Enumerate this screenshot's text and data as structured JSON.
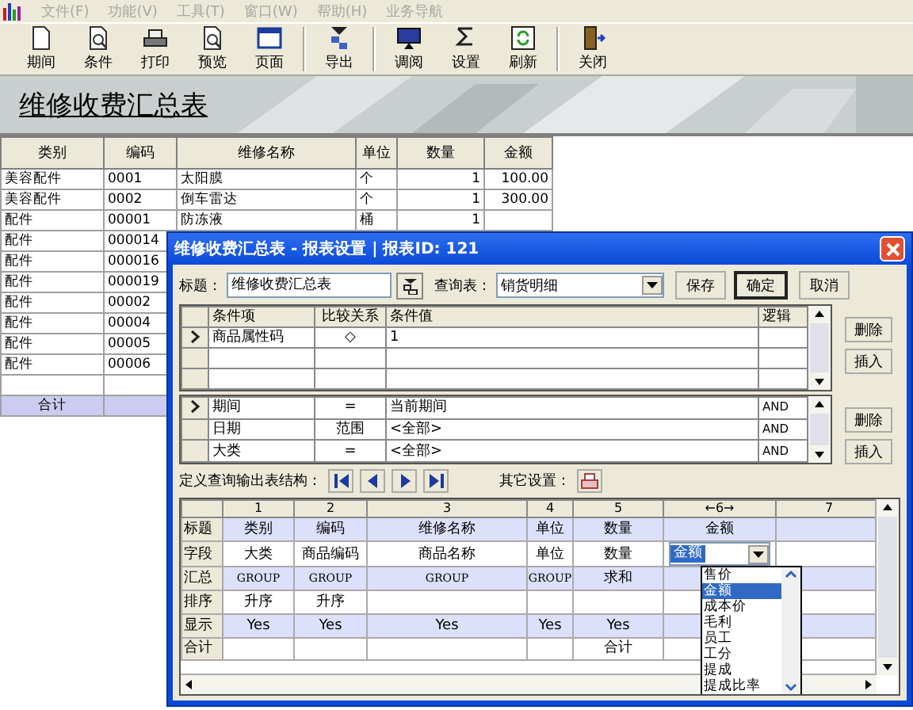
{
  "menu": [
    {
      "label": "文件(F)",
      "disabled": true
    },
    {
      "label": "功能(V)",
      "disabled": true
    },
    {
      "label": "工具(T)",
      "disabled": true
    },
    {
      "label": "窗口(W)",
      "disabled": true
    },
    {
      "label": "帮助(H)",
      "disabled": true
    },
    {
      "label": "业务导航",
      "disabled": true
    }
  ],
  "toolbar": [
    {
      "label": "期间"
    },
    {
      "label": "条件"
    },
    {
      "label": "打印"
    },
    {
      "label": "预览"
    },
    {
      "label": "页面"
    },
    {
      "label": "导出"
    },
    {
      "label": "调阅"
    },
    {
      "label": "设置"
    },
    {
      "label": "刷新"
    },
    {
      "label": "关闭"
    }
  ],
  "banner": {
    "title": "维修收费汇总表"
  },
  "report": {
    "columns": [
      "类别",
      "编码",
      "维修名称",
      "单位",
      "数量",
      "金额"
    ],
    "rows": [
      [
        "美容配件",
        "0001",
        "太阳膜",
        "个",
        "1",
        "100.00"
      ],
      [
        "美容配件",
        "0002",
        "倒车雷达",
        "个",
        "1",
        "300.00"
      ],
      [
        "配件",
        "00001",
        "防冻液",
        "桶",
        "1",
        ""
      ],
      [
        "配件",
        "000014",
        "",
        "",
        "",
        ""
      ],
      [
        "配件",
        "000016",
        "",
        "",
        "",
        ""
      ],
      [
        "配件",
        "000019",
        "",
        "",
        "",
        ""
      ],
      [
        "配件",
        "00002",
        "",
        "",
        "",
        ""
      ],
      [
        "配件",
        "00004",
        "",
        "",
        "",
        ""
      ],
      [
        "配件",
        "00005",
        "",
        "",
        "",
        ""
      ],
      [
        "配件",
        "00006",
        "",
        "",
        "",
        ""
      ],
      [
        "",
        "",
        "",
        "",
        "",
        ""
      ]
    ],
    "total_label": "合计"
  },
  "dialog": {
    "title": "维修收费汇总表 - 报表设置 | 报表ID: 121",
    "title_label": "标题：",
    "title_value": "维修收费汇总表",
    "query_label": "查询表：",
    "query_value": "销货明细",
    "buttons": [
      {
        "label": "保存",
        "default": false
      },
      {
        "label": "确定",
        "default": true
      },
      {
        "label": "取消",
        "default": false
      }
    ],
    "conditions": {
      "columns": [
        "条件项",
        "比较关系",
        "条件值",
        "逻辑"
      ],
      "rows": [
        {
          "current": true,
          "cells": [
            "商品属性码",
            "◇",
            "1",
            ""
          ]
        },
        {
          "current": false,
          "cells": [
            "",
            "",
            "",
            ""
          ]
        },
        {
          "current": false,
          "cells": [
            "",
            "",
            "",
            ""
          ]
        }
      ],
      "side_buttons": [
        "删除",
        "插入"
      ]
    },
    "fixed_conditions": {
      "rows": [
        {
          "current": true,
          "cells": [
            "期间",
            "=",
            "当前期间",
            "AND"
          ]
        },
        {
          "current": false,
          "cells": [
            "日期",
            "范围",
            "<全部>",
            "AND"
          ]
        },
        {
          "current": false,
          "cells": [
            "大类",
            "=",
            "<全部>",
            "AND"
          ]
        }
      ],
      "side_buttons": [
        "删除",
        "插入"
      ]
    },
    "structure_label": "定义查询输出表结构：",
    "other_label": "其它设置：",
    "grid": {
      "columns": [
        "1",
        "2",
        "3",
        "4",
        "5",
        "←6→",
        "7"
      ],
      "rows": [
        {
          "header": "标题",
          "shaded": true,
          "cells": [
            "类别",
            "编码",
            "维修名称",
            "单位",
            "数量",
            "金额",
            ""
          ]
        },
        {
          "header": "字段",
          "shaded": false,
          "cells": [
            "大类",
            "商品编码",
            "商品名称",
            "单位",
            "数量",
            "",
            ""
          ]
        },
        {
          "header": "汇总",
          "shaded": true,
          "cells": [
            "GROUP",
            "GROUP",
            "GROUP",
            "GROUP",
            "求和",
            "",
            ""
          ]
        },
        {
          "header": "排序",
          "shaded": false,
          "cells": [
            "升序",
            "升序",
            "",
            "",
            "",
            "",
            ""
          ]
        },
        {
          "header": "显示",
          "shaded": true,
          "cells": [
            "Yes",
            "Yes",
            "Yes",
            "Yes",
            "Yes",
            "",
            ""
          ]
        },
        {
          "header": "合计",
          "shaded": false,
          "cells": [
            "",
            "",
            "",
            "",
            "合计",
            "",
            ""
          ]
        }
      ]
    },
    "field_dropdown": {
      "value": "金额",
      "options": [
        {
          "label": "售价",
          "selected": false
        },
        {
          "label": "金额",
          "selected": true
        },
        {
          "label": "成本价",
          "selected": false
        },
        {
          "label": "毛利",
          "selected": false
        },
        {
          "label": "员工",
          "selected": false
        },
        {
          "label": "工分",
          "selected": false
        },
        {
          "label": "提成",
          "selected": false
        },
        {
          "label": "提成比率",
          "selected": false
        }
      ]
    }
  }
}
